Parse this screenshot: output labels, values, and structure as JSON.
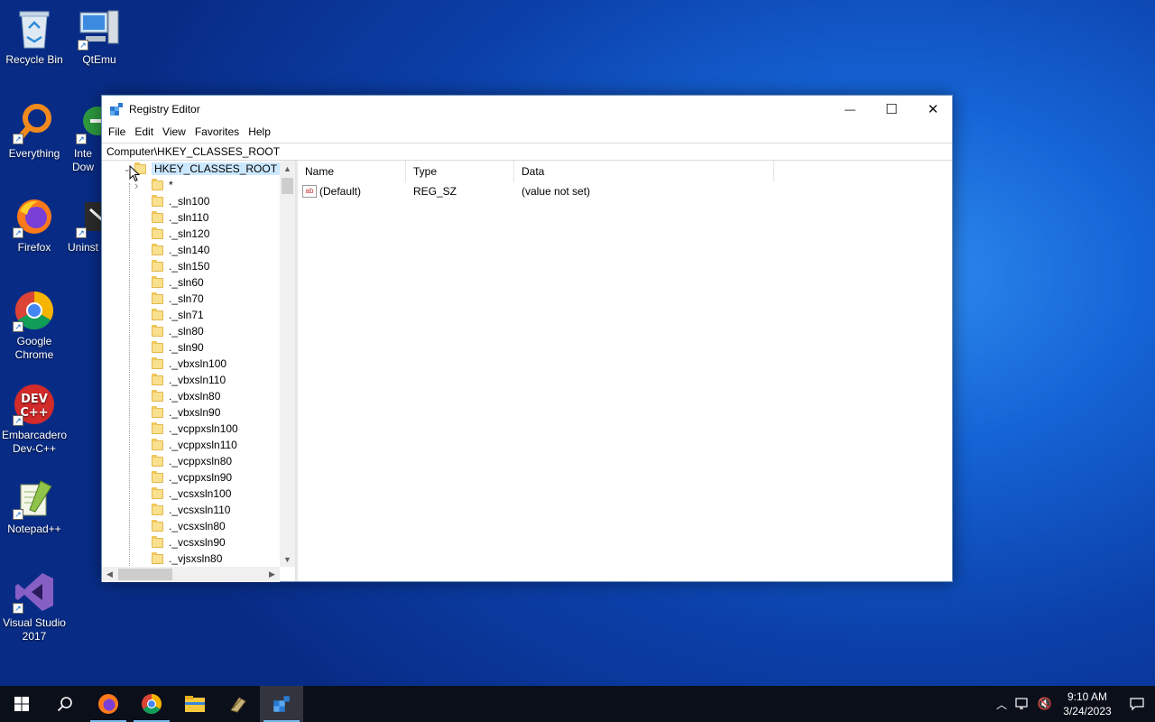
{
  "desktop": {
    "icons": [
      {
        "label": "Recycle Bin"
      },
      {
        "label": "QtEmu"
      },
      {
        "label": "Everything"
      },
      {
        "label": "Inte Dow"
      },
      {
        "label": "Firefox"
      },
      {
        "label": "Uninst"
      },
      {
        "label": "Google Chrome"
      },
      {
        "label": "Embarcadero Dev-C++"
      },
      {
        "label": "Notepad++"
      },
      {
        "label": "Visual Studio 2017"
      }
    ]
  },
  "window": {
    "title": "Registry Editor",
    "controls": {
      "minimize": "—",
      "maximize": "☐",
      "close": "✕"
    },
    "menu": [
      "File",
      "Edit",
      "View",
      "Favorites",
      "Help"
    ],
    "address": "Computer\\HKEY_CLASSES_ROOT",
    "tree": {
      "root": "HKEY_CLASSES_ROOT",
      "children": [
        "*",
        "._sln100",
        "._sln110",
        "._sln120",
        "._sln140",
        "._sln150",
        "._sln60",
        "._sln70",
        "._sln71",
        "._sln80",
        "._sln90",
        "._vbxsln100",
        "._vbxsln110",
        "._vbxsln80",
        "._vbxsln90",
        "._vcppxsln100",
        "._vcppxsln110",
        "._vcppxsln80",
        "._vcppxsln90",
        "._vcsxsln100",
        "._vcsxsln110",
        "._vcsxsln80",
        "._vcsxsln90",
        "._vjsxsln80"
      ]
    },
    "list": {
      "columns": [
        "Name",
        "Type",
        "Data"
      ],
      "rows": [
        {
          "name": "(Default)",
          "type": "REG_SZ",
          "data": "(value not set)"
        }
      ],
      "value_icon_text": "ab"
    }
  },
  "taskbar": {
    "items": [
      "start",
      "search",
      "firefox",
      "chrome",
      "file-explorer",
      "app",
      "registry-editor"
    ],
    "active": "registry-editor",
    "clock": {
      "time": "9:10 AM",
      "date": "3/24/2023"
    }
  }
}
